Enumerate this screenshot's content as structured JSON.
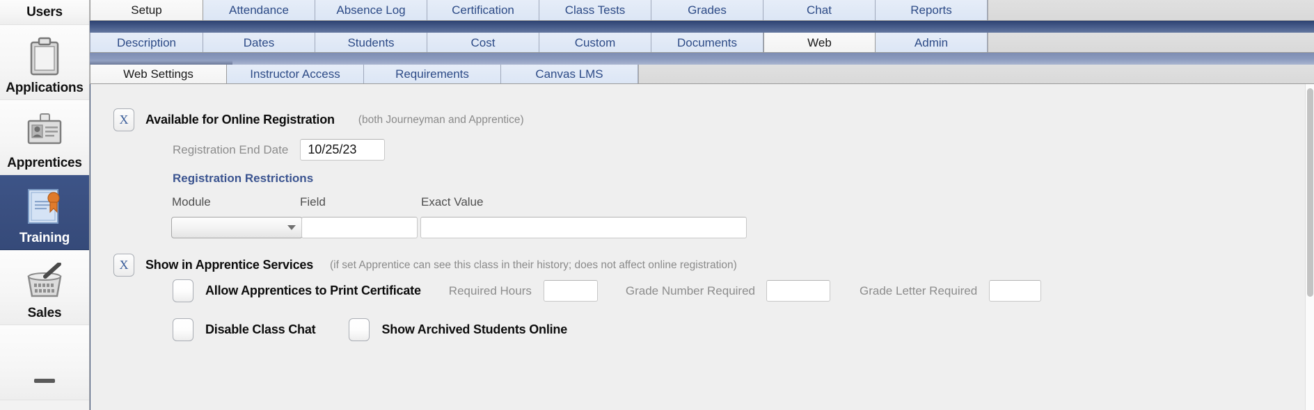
{
  "sidebar": {
    "items": [
      {
        "label": "Users",
        "icon": "users-icon",
        "selected": false,
        "partial_top": true
      },
      {
        "label": "Applications",
        "icon": "clipboard-icon",
        "selected": false
      },
      {
        "label": "Apprentices",
        "icon": "id-badge-icon",
        "selected": false
      },
      {
        "label": "Training",
        "icon": "certificate-icon",
        "selected": true
      },
      {
        "label": "Sales",
        "icon": "basket-icon",
        "selected": false
      }
    ]
  },
  "tabs_level1": {
    "items": [
      {
        "label": "Setup",
        "active": true
      },
      {
        "label": "Attendance",
        "active": false
      },
      {
        "label": "Absence Log",
        "active": false
      },
      {
        "label": "Certification",
        "active": false
      },
      {
        "label": "Class Tests",
        "active": false
      },
      {
        "label": "Grades",
        "active": false
      },
      {
        "label": "Chat",
        "active": false
      },
      {
        "label": "Reports",
        "active": false
      }
    ]
  },
  "tabs_level2": {
    "items": [
      {
        "label": "Description",
        "active": false
      },
      {
        "label": "Dates",
        "active": false
      },
      {
        "label": "Students",
        "active": false
      },
      {
        "label": "Cost",
        "active": false
      },
      {
        "label": "Custom",
        "active": false
      },
      {
        "label": "Documents",
        "active": false
      },
      {
        "label": "Web",
        "active": true
      },
      {
        "label": "Admin",
        "active": false
      }
    ]
  },
  "tabs_level3": {
    "items": [
      {
        "label": "Web Settings",
        "active": true
      },
      {
        "label": "Instructor Access",
        "active": false
      },
      {
        "label": "Requirements",
        "active": false
      },
      {
        "label": "Canvas LMS",
        "active": false
      }
    ]
  },
  "form": {
    "online_registration": {
      "checkbox_value": "X",
      "label": "Available for Online Registration",
      "note": "(both Journeyman and Apprentice)",
      "end_date_label": "Registration End Date",
      "end_date_value": "10/25/23"
    },
    "registration_restrictions": {
      "heading": "Registration Restrictions",
      "columns": [
        "Module",
        "Field",
        "Exact Value"
      ],
      "module_value": "",
      "field_value": "",
      "exact_value": ""
    },
    "apprentice_services": {
      "checkbox_value": "X",
      "label": "Show in Apprentice Services",
      "note": "(if set Apprentice can see this class in their history; does not affect online registration)",
      "print_certificate": {
        "checked": false,
        "label": "Allow Apprentices to Print Certificate"
      },
      "required_hours": {
        "label": "Required Hours",
        "value": ""
      },
      "grade_number_required": {
        "label": "Grade Number Required",
        "value": ""
      },
      "grade_letter_required": {
        "label": "Grade Letter Required",
        "value": ""
      },
      "disable_class_chat": {
        "checked": false,
        "label": "Disable Class Chat"
      },
      "show_archived_students": {
        "checked": false,
        "label": "Show Archived Students Online"
      }
    }
  },
  "colors": {
    "accent_blue": "#3b5490",
    "tab_blue": "#dce6f5",
    "selected_nav": "#3a4f80",
    "divider_dark": "#2e4372",
    "divider_light": "#8a99bd"
  }
}
